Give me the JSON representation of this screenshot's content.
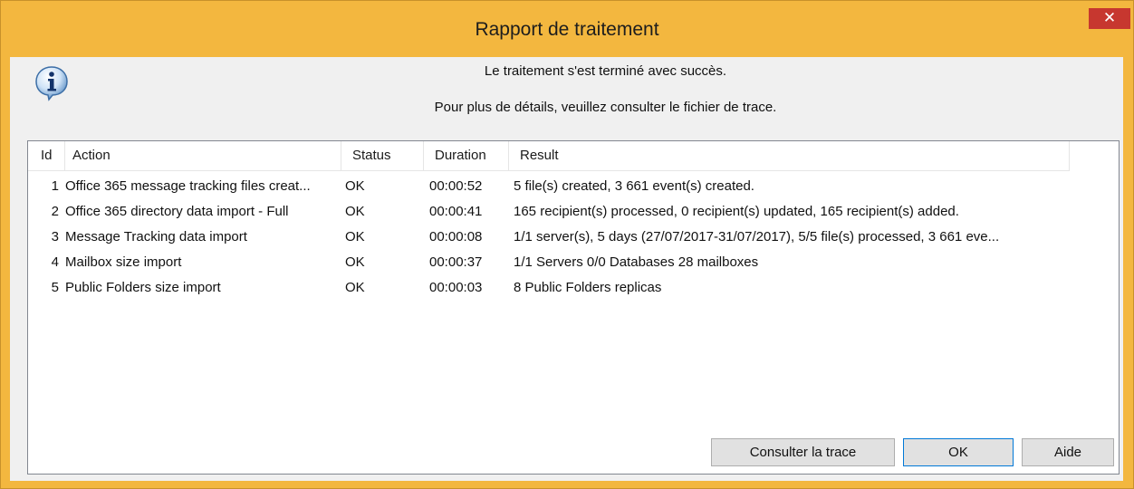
{
  "window": {
    "title": "Rapport de traitement",
    "close_label": "✕"
  },
  "icons": {
    "info": "info-icon",
    "close": "close-icon"
  },
  "messages": {
    "line1": "Le traitement s'est terminé avec succès.",
    "line2": "Pour plus de détails, veuillez consulter le fichier de trace."
  },
  "table": {
    "headers": {
      "id": "Id",
      "action": "Action",
      "status": "Status",
      "duration": "Duration",
      "result": "Result"
    },
    "rows": [
      {
        "id": "1",
        "action": "Office 365 message tracking files creat...",
        "status": "OK",
        "duration": "00:00:52",
        "result": "5 file(s) created, 3 661 event(s) created."
      },
      {
        "id": "2",
        "action": "Office 365 directory data import - Full",
        "status": "OK",
        "duration": "00:00:41",
        "result": "165 recipient(s) processed, 0 recipient(s) updated, 165 recipient(s) added."
      },
      {
        "id": "3",
        "action": "Message Tracking data import",
        "status": "OK",
        "duration": "00:00:08",
        "result": "1/1 server(s), 5 days (27/07/2017-31/07/2017), 5/5 file(s) processed, 3 661 eve..."
      },
      {
        "id": "4",
        "action": "Mailbox size import",
        "status": "OK",
        "duration": "00:00:37",
        "result": "1/1 Servers 0/0 Databases 28 mailboxes"
      },
      {
        "id": "5",
        "action": "Public Folders size import",
        "status": "OK",
        "duration": "00:00:03",
        "result": "8 Public Folders replicas"
      }
    ]
  },
  "buttons": {
    "trace": "Consulter la trace",
    "ok": "OK",
    "help": "Aide"
  },
  "colors": {
    "frame": "#f3b73f",
    "close": "#c7372f",
    "client": "#f0f0f0",
    "focus": "#0078d7"
  }
}
